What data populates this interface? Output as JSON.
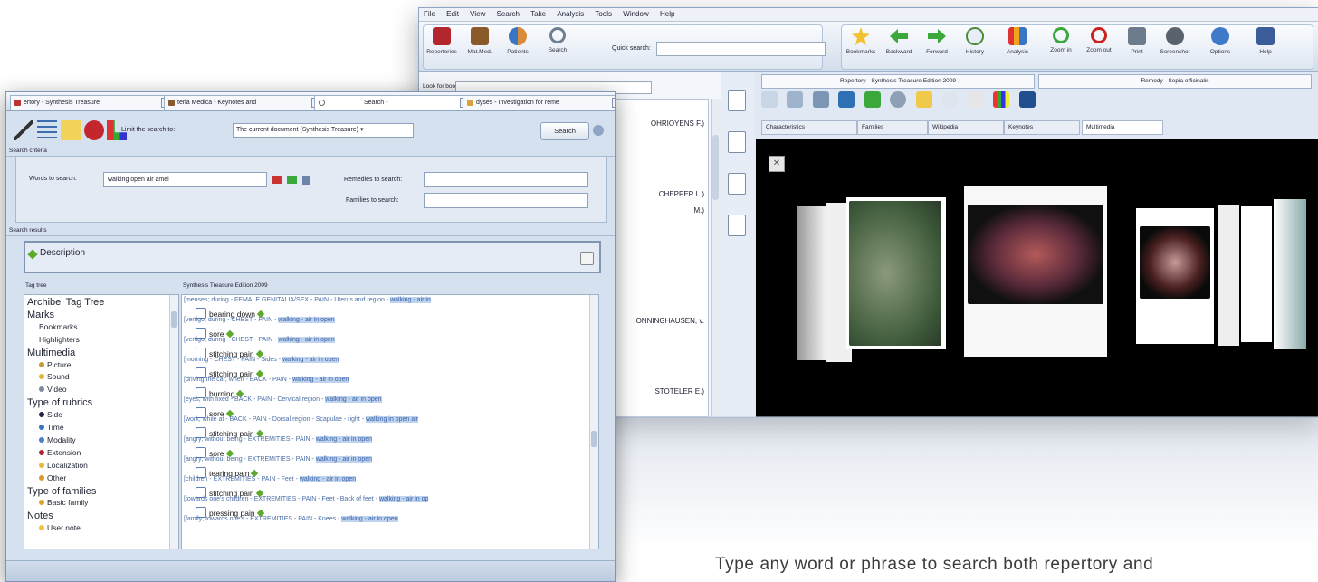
{
  "back_window": {
    "menu": [
      "File",
      "Edit",
      "View",
      "Search",
      "Take",
      "Analysis",
      "Tools",
      "Window",
      "Help"
    ],
    "toolbar_left": [
      "Repertories",
      "Mat.Med.",
      "Patients",
      "Search"
    ],
    "quick_search_label": "Quick search:",
    "toolbar_right": [
      "Bookmarks",
      "Backward",
      "Forward",
      "History",
      "Analysis",
      "Zoom in",
      "Zoom out",
      "Print",
      "Screenshot",
      "Options",
      "Help"
    ],
    "look_for_books_label": "Look for books:",
    "book_list": [
      "OHRIOYENS F.)",
      "CHEPPER L.)",
      "M.)",
      "ONNINGHAUSEN, v.",
      "STOTELER E.)"
    ],
    "repertory_tab": "Repertory - Synthesis Treasure Edition 2009",
    "remedy_tab": "Remedy - Sepia officinalis",
    "remedy_subtabs": [
      "Characteristics",
      "Families",
      "Wikipedia",
      "Keynotes",
      "Multimedia"
    ],
    "active_subtab": "Multimedia"
  },
  "front_window": {
    "tabs": [
      "ertory - Synthesis Treasure",
      "teria Medica - Keynotes and",
      "Search -",
      "dyses - Investigation for reme"
    ],
    "limit_label": "Limit the search to:",
    "limit_value": "The current document (Synthesis Treasure)",
    "search_button": "Search",
    "search_criteria_title": "Search criteria",
    "words_label": "Words to search:",
    "words_value": "walking open air amel",
    "remedies_label": "Remedies to search:",
    "families_label": "Families to search:",
    "search_results_title": "Search results",
    "description_label": "Description",
    "tag_tree_title": "Tag tree",
    "results_title": "Synthesis Treasure Edition 2009",
    "tag_tree": [
      {
        "text": "Archibel Tag Tree",
        "level": 0
      },
      {
        "text": "Marks",
        "level": 0
      },
      {
        "text": "Bookmarks",
        "level": 1
      },
      {
        "text": "Highlighters",
        "level": 1
      },
      {
        "text": "Multimedia",
        "level": 0
      },
      {
        "text": "Picture",
        "level": 1
      },
      {
        "text": "Sound",
        "level": 1
      },
      {
        "text": "Video",
        "level": 1
      },
      {
        "text": "Type of rubrics",
        "level": 0
      },
      {
        "text": "Side",
        "level": 1
      },
      {
        "text": "Time",
        "level": 1
      },
      {
        "text": "Modality",
        "level": 1
      },
      {
        "text": "Extension",
        "level": 1
      },
      {
        "text": "Localization",
        "level": 1
      },
      {
        "text": "Other",
        "level": 1
      },
      {
        "text": "Type of families",
        "level": 0
      },
      {
        "text": "Basic family",
        "level": 1
      },
      {
        "text": "Notes",
        "level": 0
      },
      {
        "text": "User note",
        "level": 1
      }
    ],
    "results": [
      {
        "line": "[menses; during - FEMALE GENITALIA/SEX - PAIN - Uterus and region -",
        "hl": "walking - air in",
        "sub": "bearing down"
      },
      {
        "line": "[vertigo; during - CHEST - PAIN -",
        "hl": "walking - air in open",
        "sub": "sore"
      },
      {
        "line": "[vertigo; during - CHEST - PAIN -",
        "hl": "walking - air in open",
        "sub": "stitching pain"
      },
      {
        "line": "[morning - CHEST - PAIN - Sides -",
        "hl": "walking - air in open",
        "sub": "stitching pain"
      },
      {
        "line": "[driving the car; when - BACK - PAIN -",
        "hl": "walking - air in open",
        "sub": "burning"
      },
      {
        "line": "[eyes; with fixed - BACK - PAIN - Cervical region -",
        "hl": "walking - air in open",
        "sub": "sore"
      },
      {
        "line": "[work; while at - BACK - PAIN - Dorsal region - Scapulae - right -",
        "hl": "walking in open air",
        "sub": "stitching pain"
      },
      {
        "line": "[angry; without being - EXTREMITIES - PAIN -",
        "hl": "walking - air in open",
        "sub": "sore"
      },
      {
        "line": "[angry; without being - EXTREMITIES - PAIN -",
        "hl": "walking - air in open",
        "sub": "tearing pain"
      },
      {
        "line": "[children - EXTREMITIES - PAIN - Feet -",
        "hl": "walking - air in open",
        "sub": "stitching pain"
      },
      {
        "line": "[towards one's children - EXTREMITIES - PAIN - Feet - Back of feet -",
        "hl": "walking - air in op",
        "sub": "pressing pain"
      },
      {
        "line": "[family; towards one's - EXTREMITIES - PAIN - Knees -",
        "hl": "walking - air in open",
        "sub": ""
      }
    ]
  },
  "caption": "Type any word or phrase to search both repertory and",
  "colors": {
    "accent": "#5b7fb5",
    "green_tag": "#5cab2e",
    "highlight": "#bfd3ef"
  }
}
